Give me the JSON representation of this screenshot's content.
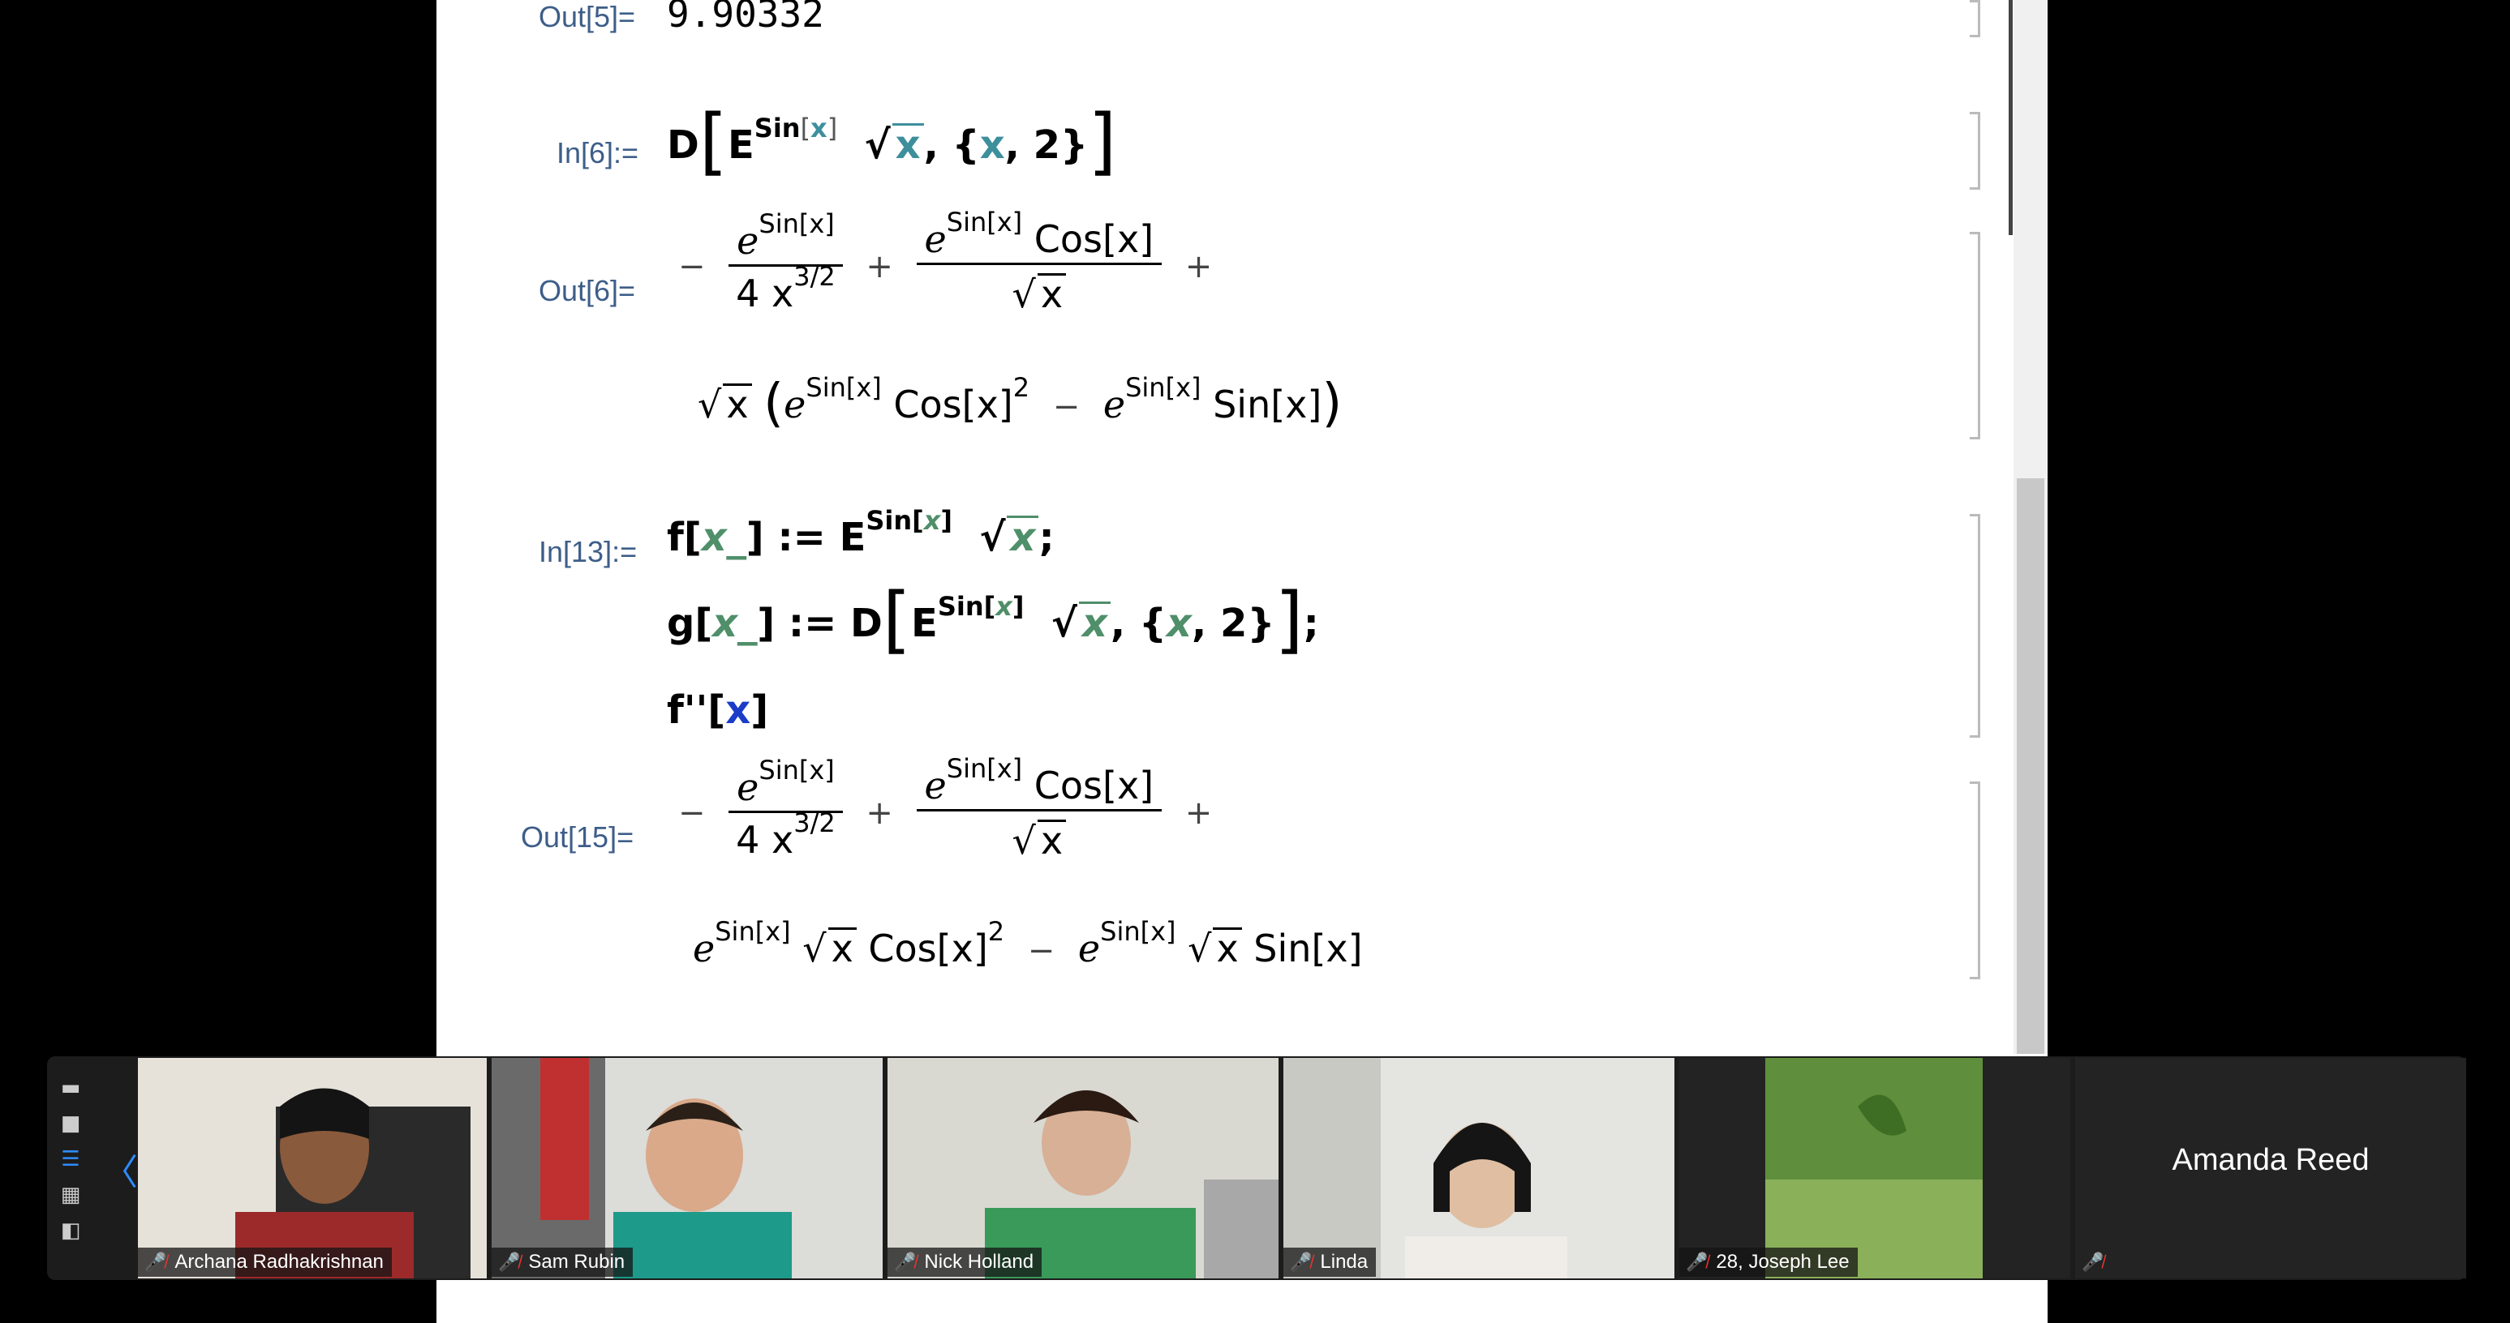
{
  "notebook": {
    "out5_label": "Out[5]=",
    "out5_value": "9.90332",
    "in6_label": "In[6]:=",
    "out6_label": "Out[6]=",
    "in13_label": "In[13]:=",
    "out15_label": "Out[15]=",
    "sin_x": "Sin[x]",
    "fdef": "f[x_] := ",
    "gdef": "g[x_] := D",
    "fcall": "f''[x]"
  },
  "zoom": {
    "participants": [
      {
        "name": "Archana Radhakrishnan",
        "muted": true
      },
      {
        "name": "Sam Rubin",
        "muted": true
      },
      {
        "name": "Nick Holland",
        "muted": true
      },
      {
        "name": "Linda",
        "muted": true
      },
      {
        "name": "28, Joseph Lee",
        "muted": true
      },
      {
        "name": "Amanda Reed",
        "muted": true
      }
    ],
    "view_icons": [
      "minimize-icon",
      "single-view-icon",
      "strip-view-icon",
      "gallery-view-icon",
      "side-by-side-icon"
    ]
  },
  "colors": {
    "label": "#3e5e89",
    "zoom_accent": "#2d8cff",
    "mute_red": "#e33"
  }
}
